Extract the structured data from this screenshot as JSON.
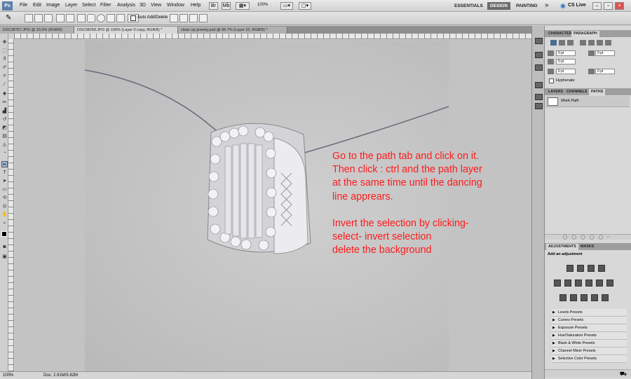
{
  "app": {
    "logo": "Ps"
  },
  "menubar": {
    "items": [
      "File",
      "Edit",
      "Image",
      "Layer",
      "Select",
      "Filter",
      "Analysis",
      "3D",
      "View",
      "Window",
      "Help"
    ],
    "zoom": "100%",
    "workspaces": [
      "ESSENTIALS",
      "DESIGN",
      "PAINTING"
    ],
    "overflow": "»",
    "cslive": "CS Live"
  },
  "options": {
    "auto_add_delete": "Auto Add/Delete"
  },
  "doc_tabs": [
    "DSC08757.JPG @ 33.3% (RGB/8)",
    "DSC08258.JPG @ 100% (Layer 0 copy, RGB/8) *",
    "clean up jewelry.psd @ 66.7% (Layer 10, RGB/8) *"
  ],
  "note": {
    "lines": [
      "Go  to the path tab and click on it.",
      "Then click : ctrl and the path layer",
      "at the same time until the dancing",
      "line apprears.",
      "",
      "Invert the selection by clicking-",
      "select- invert selection",
      "delete the background"
    ],
    "color": "#ff1a1a"
  },
  "status": {
    "zoom": "100%",
    "doc": "Doc: 2.91M/5.82M"
  },
  "character_panel": {
    "tabs": [
      "CHARACTER",
      "PARAGRAPH"
    ],
    "fields": [
      "0 pt",
      "0 pt",
      "0 pt",
      "0 pt",
      "0 pt",
      "0 pt",
      "0 pt"
    ],
    "hyphenate": "Hyphenate"
  },
  "layers_panel": {
    "tabs": [
      "LAYERS",
      "CHANNELS",
      "PATHS"
    ],
    "path_name": "Work Path"
  },
  "adjustments_panel": {
    "tabs": [
      "ADJUSTMENTS",
      "MASKS"
    ],
    "heading": "Add an adjustment",
    "presets": [
      "Levels Presets",
      "Curves Presets",
      "Exposure Presets",
      "Hue/Saturation Presets",
      "Black & White Presets",
      "Channel Mixer Presets",
      "Selective Color Presets"
    ]
  },
  "colors": {
    "arrow": "#e8141e",
    "accent": "#5b7fa8"
  }
}
